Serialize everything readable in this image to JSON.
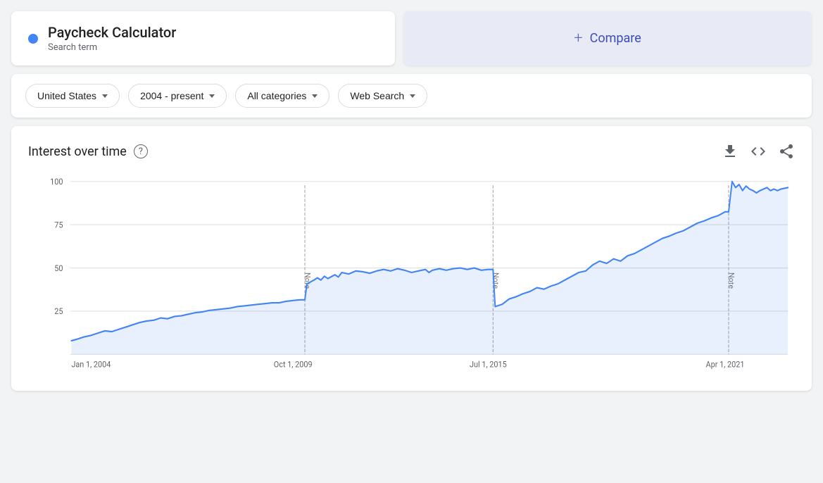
{
  "search_term": {
    "label": "Paycheck Calculator",
    "type": "Search term",
    "dot_color": "#4285f4"
  },
  "compare": {
    "label": "Compare",
    "plus_symbol": "+"
  },
  "filters": [
    {
      "id": "region",
      "label": "United States"
    },
    {
      "id": "time",
      "label": "2004 - present"
    },
    {
      "id": "category",
      "label": "All categories"
    },
    {
      "id": "search_type",
      "label": "Web Search"
    }
  ],
  "chart": {
    "title": "Interest over time",
    "help_text": "?",
    "x_labels": [
      "Jan 1, 2004",
      "Oct 1, 2009",
      "Jul 1, 2015",
      "Apr 1, 2021"
    ],
    "y_labels": [
      "100",
      "75",
      "50",
      "25"
    ],
    "notes": [
      "Note",
      "Note",
      "Note"
    ],
    "download_icon": "⬇",
    "embed_icon": "<>",
    "share_icon": "share"
  }
}
